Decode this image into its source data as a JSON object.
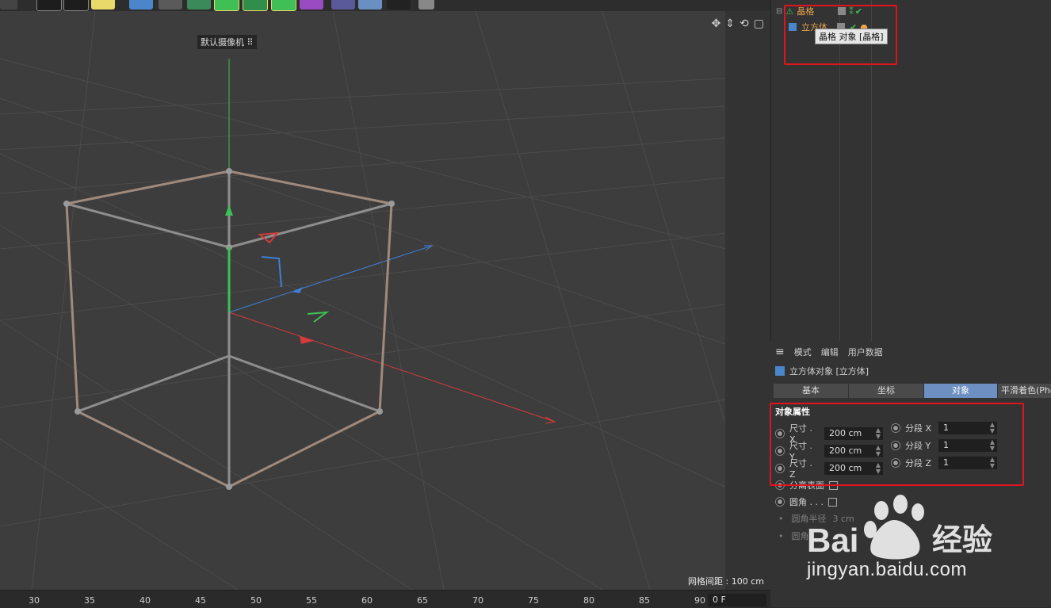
{
  "viewport": {
    "camera_label": "默认摄像机",
    "grid_spacing": "网格间距 : 100 cm"
  },
  "timeline": {
    "ticks": [
      "30",
      "35",
      "40",
      "45",
      "50",
      "55",
      "60",
      "65",
      "70",
      "75",
      "80",
      "85",
      "90"
    ],
    "frame": "0 F"
  },
  "object_manager": {
    "items": [
      {
        "name": "晶格",
        "color": "#e8a24a"
      },
      {
        "name": "立方体",
        "color": "#e8a24a"
      }
    ],
    "tooltip": "晶格 对象 [晶格]"
  },
  "attributes": {
    "menu": [
      "模式",
      "编辑",
      "用户数据"
    ],
    "object_title": "立方体对象 [立方体]",
    "tabs": [
      "基本",
      "坐标",
      "对象",
      "平滑着色(Pho"
    ],
    "active_tab": "对象",
    "section_title": "对象属性",
    "size": [
      {
        "label": "尺寸 . X",
        "value": "200 cm"
      },
      {
        "label": "尺寸 . Y",
        "value": "200 cm"
      },
      {
        "label": "尺寸 . Z",
        "value": "200 cm"
      }
    ],
    "segments": [
      {
        "label": "分段 X",
        "value": "1"
      },
      {
        "label": "分段 Y",
        "value": "1"
      },
      {
        "label": "分段 Z",
        "value": "1"
      }
    ],
    "separate_surfaces": "分离表面",
    "fillet": "圆角 . . .",
    "fillet_radius_label": "圆角半径",
    "fillet_radius_value": "3 cm",
    "fillet_subdivision": "圆角"
  },
  "watermark": {
    "brand": "Bai du 经验",
    "url": "jingyan.baidu.com"
  },
  "colors": {
    "accent_tab": "#6d8fc2",
    "highlight_box": "#e0141e",
    "axis_x": "#d63a3a",
    "axis_y": "#3fbf55",
    "axis_z": "#3f7fd6"
  }
}
